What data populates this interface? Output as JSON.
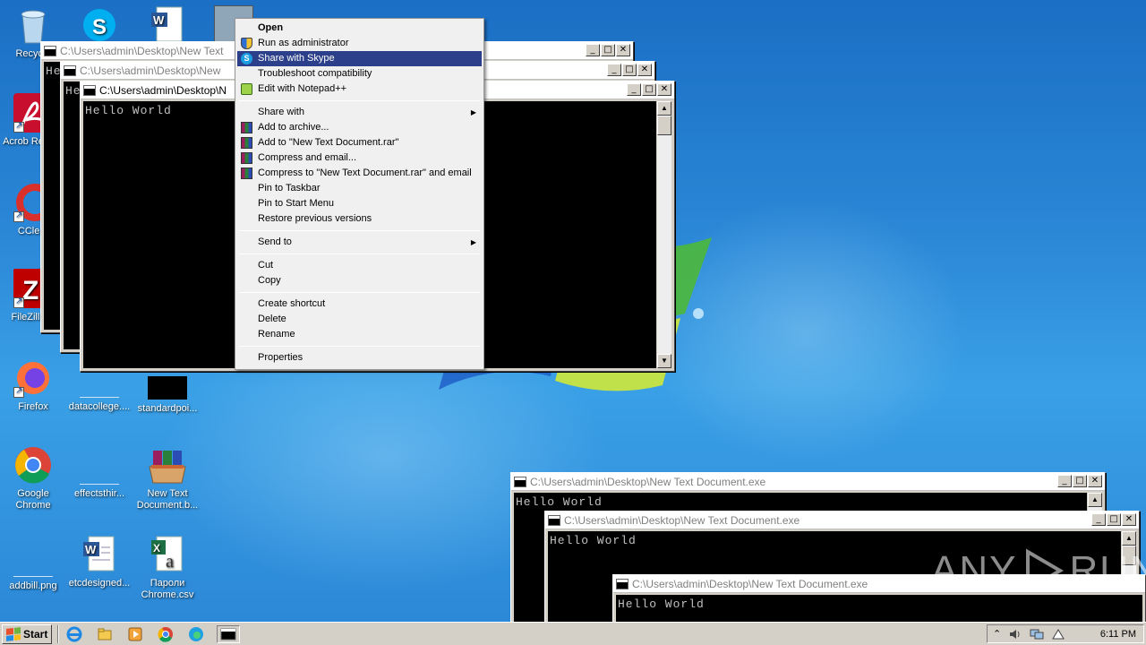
{
  "desktop": {
    "icons": [
      {
        "label": "Recycle",
        "icon": "recycle-bin-icon"
      },
      {
        "label": "Acrob Reader",
        "icon": "acrobat-reader-icon"
      },
      {
        "label": "CClear",
        "icon": "ccleaner-icon"
      },
      {
        "label": "FileZilla C",
        "icon": "filezilla-icon"
      },
      {
        "label": "Firefox",
        "icon": "firefox-icon"
      },
      {
        "label": "datacollege....",
        "icon": "blank-file-icon"
      },
      {
        "label": "standardpoi...",
        "icon": "black-image-icon"
      },
      {
        "label": "Google Chrome",
        "icon": "chrome-icon"
      },
      {
        "label": "effectsthir...",
        "icon": "blank-file-icon"
      },
      {
        "label": "New Text Document.b...",
        "icon": "winrar-archive-icon"
      },
      {
        "label": "addbill.png",
        "icon": "blank-file-icon"
      },
      {
        "label": "etcdesigned...",
        "icon": "word-document-icon"
      },
      {
        "label": "Пароли Chrome.csv",
        "icon": "excel-csv-icon"
      },
      {
        "label": "",
        "icon": "skype-icon"
      },
      {
        "label": "",
        "icon": "word-document-icon"
      },
      {
        "label": "",
        "icon": "window-icon"
      }
    ]
  },
  "consoles": [
    {
      "title": "C:\\Users\\admin\\Desktop\\New Text",
      "output": "He"
    },
    {
      "title": "C:\\Users\\admin\\Desktop\\New",
      "output": "He"
    },
    {
      "title": "C:\\Users\\admin\\Desktop\\N",
      "output": "Hello World"
    },
    {
      "title": "C:\\Users\\admin\\Desktop\\New Text Document.exe",
      "output": "Hello World"
    },
    {
      "title": "C:\\Users\\admin\\Desktop\\New Text Document.exe",
      "output": "Hello World"
    },
    {
      "title": "C:\\Users\\admin\\Desktop\\New Text Document.exe",
      "output": "Hello World"
    }
  ],
  "window_buttons": {
    "minimize": "_",
    "maximize": "□",
    "close": "✕"
  },
  "context_menu": {
    "open": "Open",
    "run_admin": "Run as administrator",
    "share_skype": "Share with Skype",
    "troubleshoot": "Troubleshoot compatibility",
    "edit_notepad": "Edit with Notepad++",
    "share_with": "Share with",
    "add_archive": "Add to archive...",
    "add_rar": "Add to \"New Text Document.rar\"",
    "compress_email": "Compress and email...",
    "compress_rar_email": "Compress to \"New Text Document.rar\" and email",
    "pin_taskbar": "Pin to Taskbar",
    "pin_start": "Pin to Start Menu",
    "restore_versions": "Restore previous versions",
    "send_to": "Send to",
    "cut": "Cut",
    "copy": "Copy",
    "create_shortcut": "Create shortcut",
    "delete": "Delete",
    "rename": "Rename",
    "properties": "Properties",
    "submenu_arrow": "▶"
  },
  "taskbar": {
    "start": "Start",
    "quicklaunch": [
      "ie-icon",
      "explorer-icon",
      "media-player-icon",
      "chrome-icon",
      "edge-icon",
      "console-window-icon"
    ],
    "clock": "6:11 PM",
    "tray_arrow": "⌃"
  },
  "watermark": {
    "left": "ANY",
    "right": "RUN"
  },
  "colors": {
    "menu_highlight": "#2b3f8a",
    "desktop_blue": "#2a86d6",
    "console_bg": "#000000"
  }
}
